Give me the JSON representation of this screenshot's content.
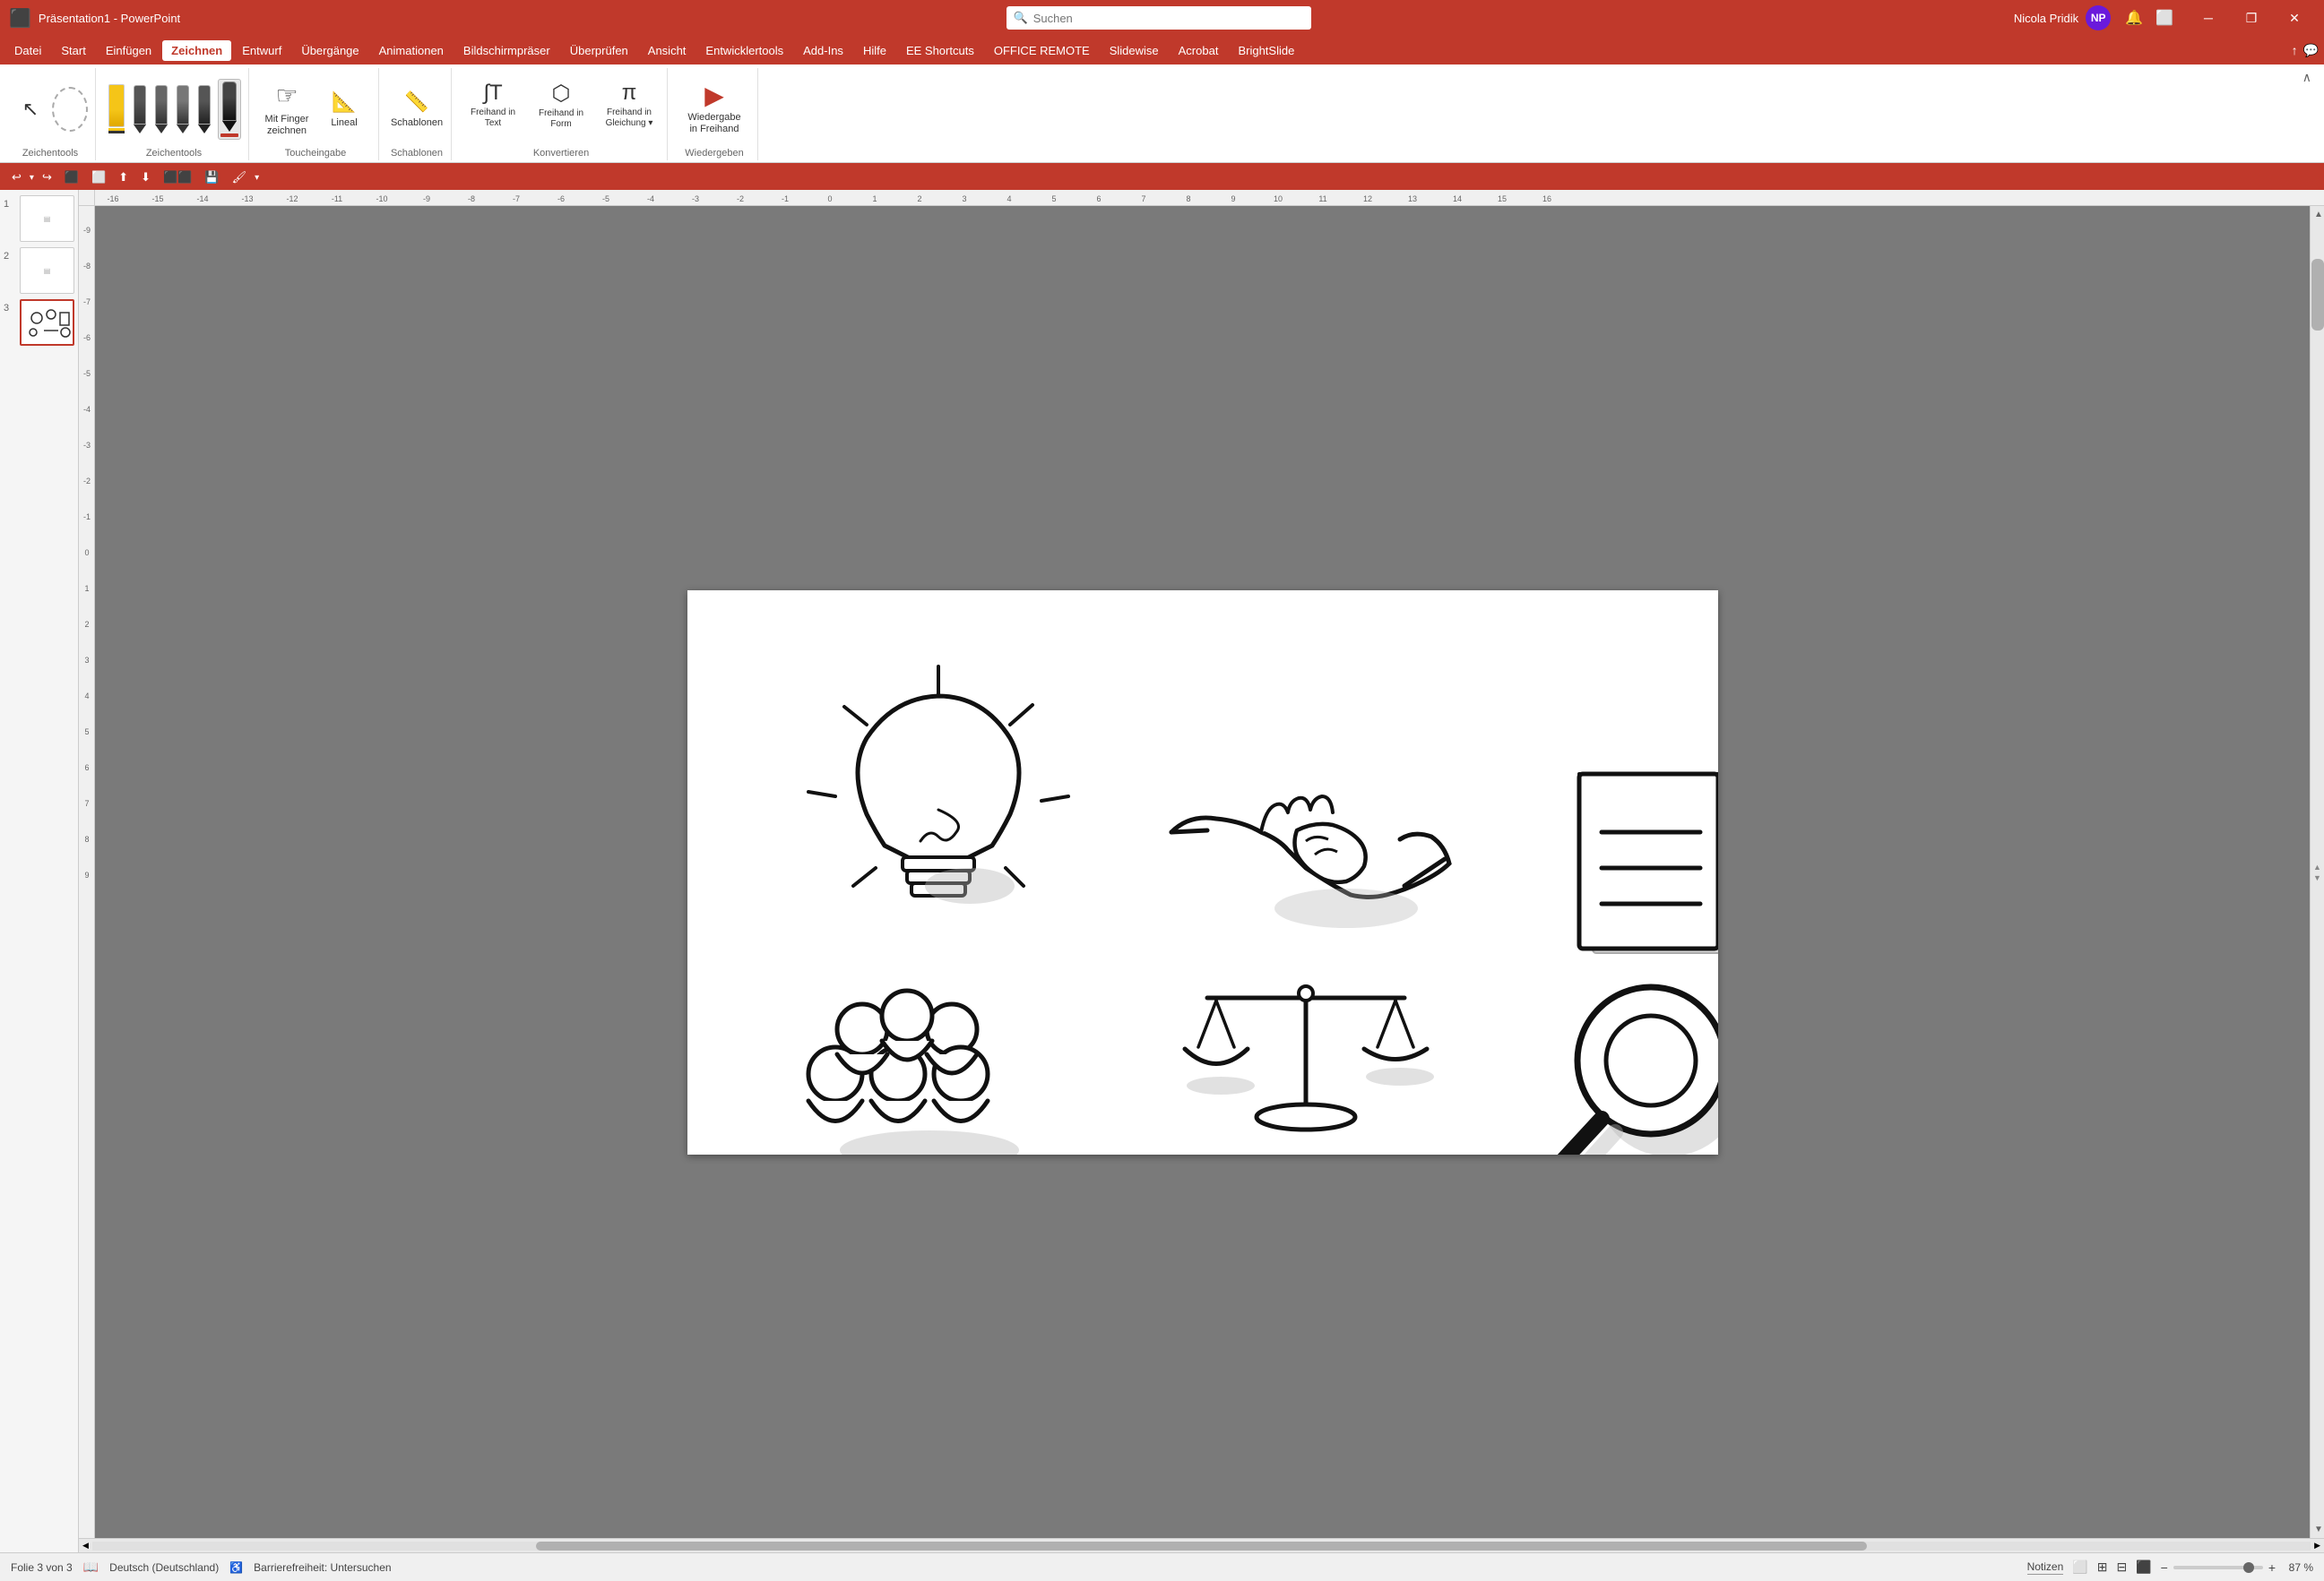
{
  "titlebar": {
    "app_name": "Präsentation1 - PowerPoint",
    "search_placeholder": "Suchen",
    "user_name": "Nicola Pridik",
    "user_initials": "NP",
    "win_minimize": "─",
    "win_restore": "❐",
    "win_close": "✕"
  },
  "menubar": {
    "items": [
      {
        "label": "Datei",
        "active": false
      },
      {
        "label": "Start",
        "active": false
      },
      {
        "label": "Einfügen",
        "active": false
      },
      {
        "label": "Zeichnen",
        "active": true
      },
      {
        "label": "Entwurf",
        "active": false
      },
      {
        "label": "Übergänge",
        "active": false
      },
      {
        "label": "Animationen",
        "active": false
      },
      {
        "label": "Bildschirmpräse",
        "active": false
      },
      {
        "label": "Überprüfen",
        "active": false
      },
      {
        "label": "Ansicht",
        "active": false
      },
      {
        "label": "Entwicklertools",
        "active": false
      },
      {
        "label": "Add-Ins",
        "active": false
      },
      {
        "label": "Hilfe",
        "active": false
      },
      {
        "label": "EE Shortcuts",
        "active": false
      },
      {
        "label": "OFFICE REMOTE",
        "active": false
      },
      {
        "label": "Slidewise",
        "active": false
      },
      {
        "label": "Acrobat",
        "active": false
      },
      {
        "label": "BrightSlide",
        "active": false
      }
    ]
  },
  "ribbon": {
    "groups": [
      {
        "name": "tools",
        "label": "Zeichentools",
        "buttons": [
          {
            "id": "select",
            "icon": "↖",
            "label": ""
          },
          {
            "id": "lasso",
            "icon": "○",
            "label": ""
          }
        ]
      },
      {
        "name": "pens",
        "label": "Zeichentools",
        "buttons": [
          {
            "id": "pen1",
            "type": "pen",
            "color": "#f5c518"
          },
          {
            "id": "pen2",
            "type": "pen",
            "color": "#2c2c2c"
          },
          {
            "id": "pen3",
            "type": "pen",
            "color": "#2c2c2c"
          },
          {
            "id": "pen4",
            "type": "pen",
            "color": "#2c2c2c"
          },
          {
            "id": "pen5",
            "type": "pen",
            "color": "#2c2c2c"
          },
          {
            "id": "pen6",
            "type": "pen-active",
            "color": "#2c2c2c"
          }
        ]
      },
      {
        "name": "touchinput",
        "label": "Toucheingabe",
        "buttons": [
          {
            "id": "finger",
            "icon": "☞",
            "label": "Mit Finger\nzeichnen"
          },
          {
            "id": "ruler",
            "icon": "📐",
            "label": "Lineal"
          }
        ]
      },
      {
        "name": "schablonen",
        "label": "Schablonen",
        "buttons": []
      },
      {
        "name": "konvertieren",
        "label": "Konvertieren",
        "buttons": [
          {
            "id": "freehand-text",
            "icon": "∫",
            "label": "Freihand in\nText"
          },
          {
            "id": "freehand-form",
            "icon": "⬡",
            "label": "Freihand in\nForm"
          },
          {
            "id": "freehand-eq",
            "icon": "π",
            "label": "Freihand in\nGleichung"
          }
        ]
      },
      {
        "name": "wiedergabe",
        "label": "Wiedergeben",
        "buttons": [
          {
            "id": "playback",
            "icon": "▶",
            "label": "Wiedergabe\nin Freihand"
          }
        ]
      }
    ]
  },
  "quickaccess": {
    "buttons": [
      {
        "id": "undo",
        "icon": "↩",
        "label": ""
      },
      {
        "id": "undo-arrow",
        "icon": "▾",
        "label": ""
      },
      {
        "id": "redo",
        "icon": "↪",
        "label": ""
      },
      {
        "id": "save-custom",
        "icon": "💾",
        "label": ""
      },
      {
        "id": "format-copy",
        "icon": "🖌",
        "label": ""
      },
      {
        "id": "format-arrow",
        "icon": "▾",
        "label": ""
      }
    ]
  },
  "slides": [
    {
      "num": "1",
      "active": false,
      "content": ""
    },
    {
      "num": "2",
      "active": false,
      "content": ""
    },
    {
      "num": "3",
      "active": true,
      "content": "icons"
    }
  ],
  "statusbar": {
    "slide_info": "Folie 3 von 3",
    "language": "Deutsch (Deutschland)",
    "accessibility": "Barrierefreiheit: Untersuchen",
    "notes_label": "Notizen",
    "zoom_level": "87 %"
  },
  "icons": {
    "search": "🔍",
    "bell": "🔔",
    "share": "↑",
    "comment": "💬"
  }
}
